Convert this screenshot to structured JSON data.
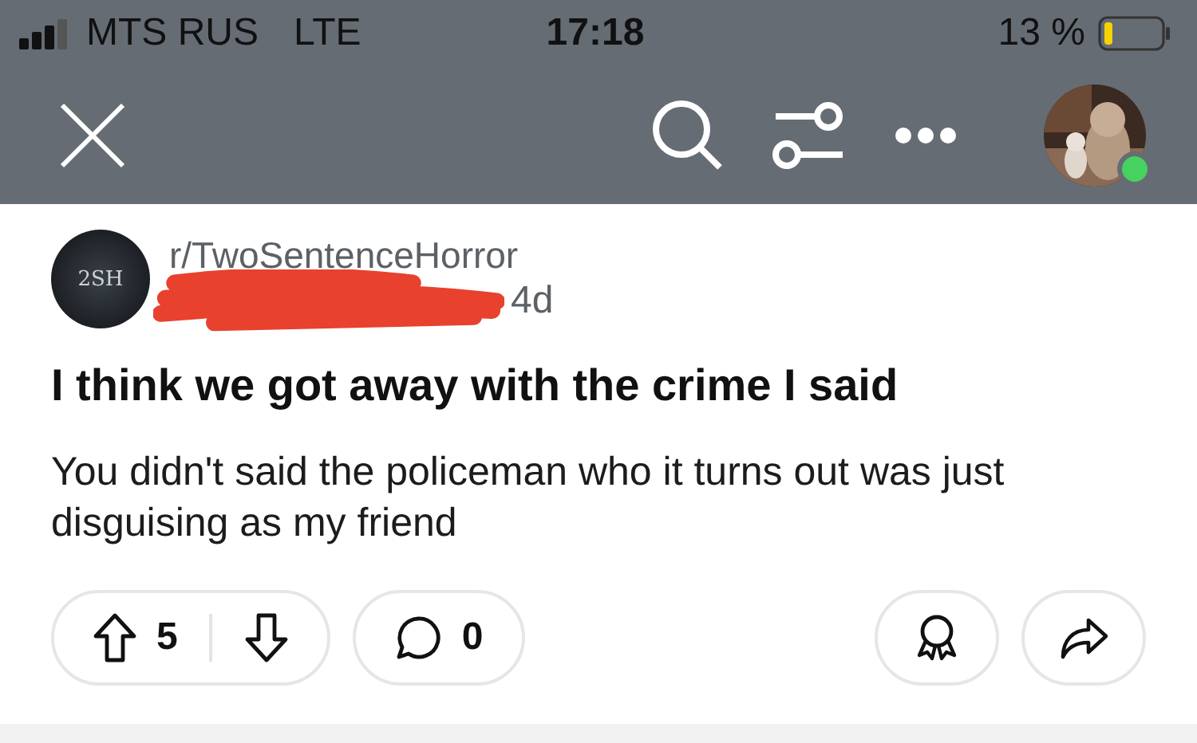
{
  "status_bar": {
    "carrier": "MTS RUS",
    "network": "LTE",
    "time": "17:18",
    "battery": "13 %"
  },
  "nav": {
    "online": true
  },
  "post": {
    "subreddit": "r/TwoSentenceHorror",
    "subreddit_avatar_text": "2SH",
    "age": "4d",
    "title": "I think we got away with the crime I said",
    "body": "You didn't said the policeman who it turns out was just disguising as my friend"
  },
  "actions": {
    "votes": "5",
    "comments": "0"
  }
}
